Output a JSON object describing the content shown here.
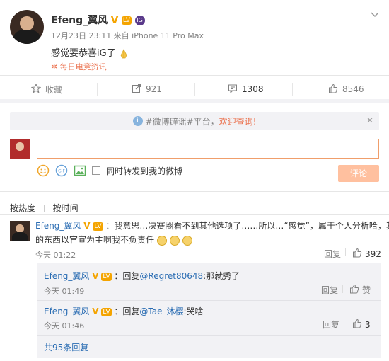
{
  "post": {
    "author": "Efeng_翼风",
    "meta": "12月23日 23:11 来自 iPhone 11 Pro Max",
    "text": "感觉要恭喜iG了",
    "tag": "每日电竞资讯",
    "more_icon": "chevron-down-icon",
    "badges": {
      "verified": "V",
      "club_short": "IG"
    }
  },
  "actions": {
    "favorite": "收藏",
    "repost_count": "921",
    "comment_count": "1308",
    "like_count": "8546"
  },
  "notice": {
    "text": "#微博辟谣#平台，",
    "link": "欢迎查询!"
  },
  "composer": {
    "checkbox_label": "同时转发到我的微博",
    "submit_label": "评论"
  },
  "sort": {
    "hot": "按热度",
    "time": "按时间"
  },
  "comments": [
    {
      "author": "Efeng_翼风",
      "text": "：我意思…决赛圈看不到其他选项了……所以…“感觉”，属于个人分析哈，其他",
      "text2": "的东西以官宣为主啊我不负责任",
      "time": "今天 01:22",
      "reply_label": "回复",
      "likes": "392",
      "replies": [
        {
          "author": "Efeng_翼风",
          "prefix": "：回复",
          "mention": "@Regret80648",
          "text": ":那就秀了",
          "time": "今天 01:49",
          "reply_label": "回复",
          "likes": "赞"
        },
        {
          "author": "Efeng_翼风",
          "prefix": "：回复",
          "mention": "@Tae_沐樱",
          "text": ":哭啥",
          "time": "今天 01:46",
          "reply_label": "回复",
          "likes": "3"
        }
      ],
      "more_replies": "共95条回复"
    }
  ],
  "colors": {
    "accent": "#eb7350",
    "link": "#2b6db3",
    "verified": "#f4a400"
  }
}
